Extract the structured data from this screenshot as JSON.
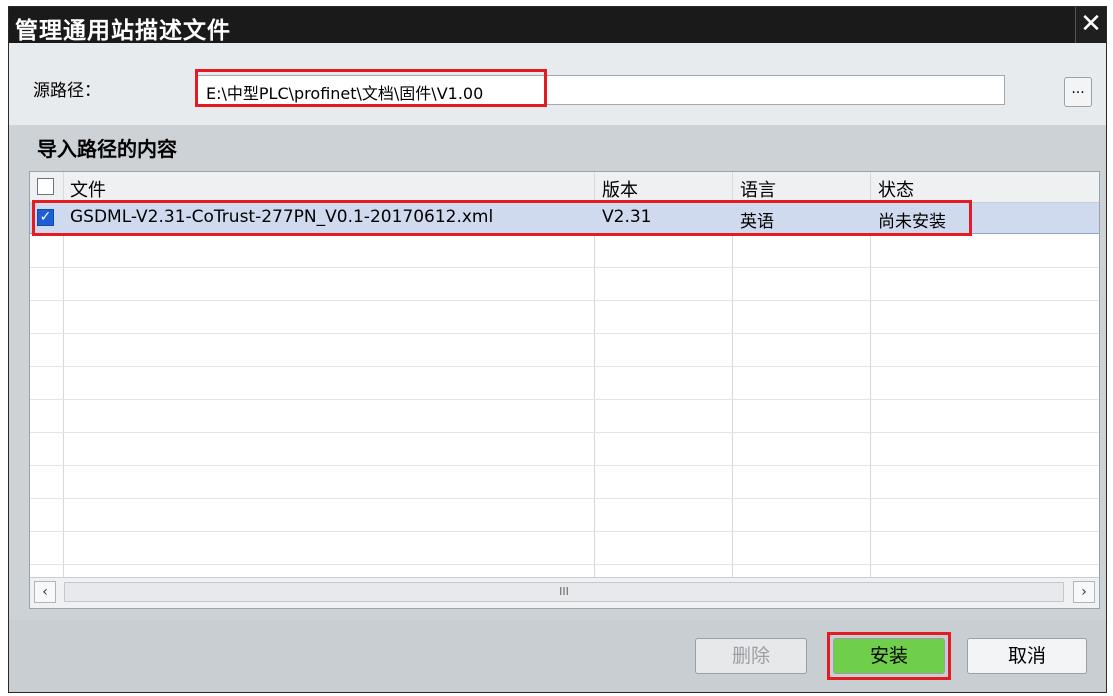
{
  "dialog": {
    "title": "管理通用站描述文件",
    "close_glyph": "✕"
  },
  "source_path": {
    "label": "源路径：",
    "value": "E:\\中型PLC\\profinet\\文档\\固件\\V1.00",
    "browse_label": "..."
  },
  "section": {
    "title": "导入路径的内容"
  },
  "table": {
    "columns": [
      "文件",
      "版本",
      "语言",
      "状态"
    ],
    "rows": [
      {
        "checked": true,
        "file": "GSDML-V2.31-CoTrust-277PN_V0.1-20170612.xml",
        "version": "V2.31",
        "language": "英语",
        "status": "尚未安装"
      }
    ]
  },
  "scrollbar": {
    "left_glyph": "‹",
    "right_glyph": "›",
    "thumb_glyph": "III"
  },
  "buttons": {
    "delete": "删除",
    "install": "安装",
    "cancel": "取消"
  },
  "colors": {
    "highlight": "#e31b23",
    "install_button": "#6fcf4a",
    "selected_row": "#cfdaee",
    "titlebar": "#1a1a1a"
  }
}
